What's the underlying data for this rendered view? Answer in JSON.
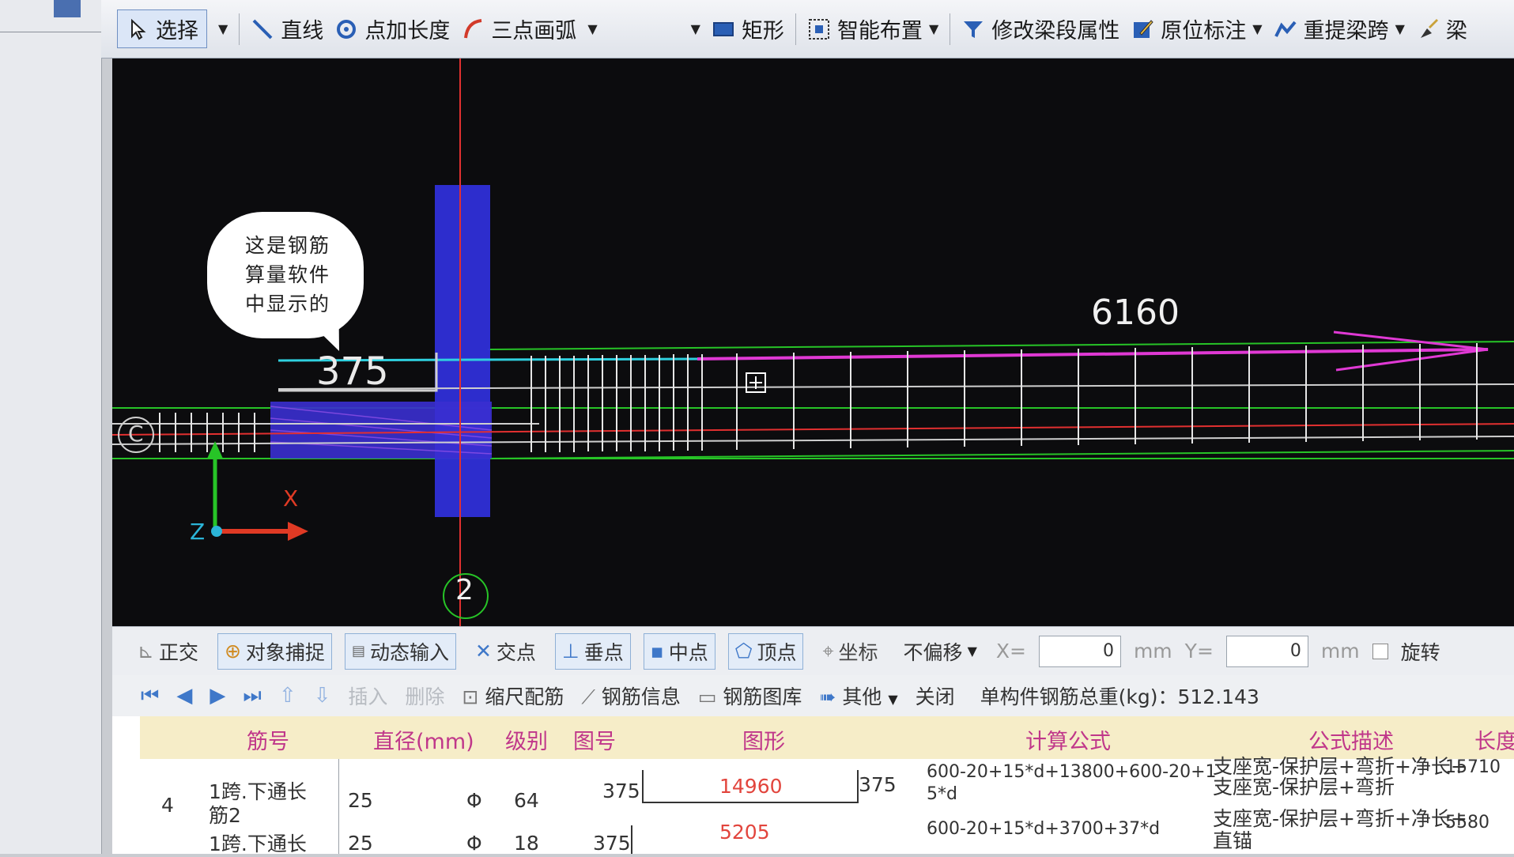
{
  "toolbar": {
    "select_label": "选择",
    "line_label": "直线",
    "point_length_label": "点加长度",
    "arc_label": "三点画弧",
    "rect_label": "矩形",
    "smart_layout_label": "智能布置",
    "modify_beam_label": "修改梁段属性",
    "inplace_label": "原位标注",
    "repick_span_label": "重提梁跨",
    "beam_partial_label": "梁"
  },
  "canvas": {
    "annotation_text": [
      "这是钢筋",
      "算量软件",
      "中显示的"
    ],
    "dim_375": "375",
    "dim_6160": "6160",
    "axis_number": "2",
    "axis_x": "X",
    "axis_z": "Z",
    "left_axis_label": "C"
  },
  "snapbar": {
    "ortho": "正交",
    "object_snap": "对象捕捉",
    "dynamic_input": "动态输入",
    "intersection": "交点",
    "perpendicular": "垂点",
    "midpoint": "中点",
    "vertex": "顶点",
    "coordinate": "坐标",
    "offset_mode": "不偏移",
    "x_label": "X=",
    "x_value": "0",
    "unit": "mm",
    "y_label": "Y=",
    "y_value": "0",
    "rotate": "旋转"
  },
  "cmdbar": {
    "insert": "插入",
    "delete": "删除",
    "scale_rebar": "缩尺配筋",
    "rebar_info": "钢筋信息",
    "rebar_library": "钢筋图库",
    "other": "其他",
    "close": "关闭",
    "total_weight_label": "单构件钢筋总重(kg)：512.143"
  },
  "table": {
    "headers": [
      "筋号",
      "直径(mm)",
      "级别",
      "图号",
      "图形",
      "计算公式",
      "公式描述",
      "长度"
    ],
    "rows": [
      {
        "index": "4",
        "name_line1": "1跨.下通长",
        "name_line2": "筋2",
        "diameter": "25",
        "grade": "Φ",
        "shape_no": "64",
        "shape_left": "375",
        "shape_mid": "14960",
        "shape_right": "375",
        "formula_line1": "600-20+15*d+13800+600-20+1",
        "formula_line2": "5*d",
        "desc_line1": "支座宽-保护层+弯折+净长+",
        "desc_line2": "支座宽-保护层+弯折",
        "length": "15710"
      },
      {
        "index": "",
        "name_line1": "1跨.下通长",
        "diameter": "25",
        "grade": "Φ",
        "shape_no": "18",
        "shape_left": "375",
        "shape_mid": "5205",
        "formula_line1": "600-20+15*d+3700+37*d",
        "desc_line1": "支座宽-保护层+弯折+净长+",
        "desc_line2": "直锚",
        "length": "5580"
      }
    ]
  }
}
